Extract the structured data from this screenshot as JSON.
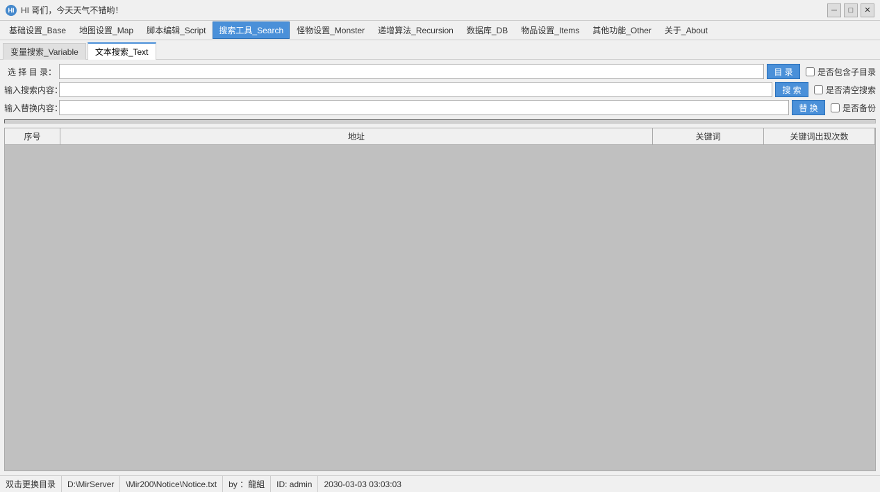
{
  "titlebar": {
    "title": "HI 哥们，今天天气不错哟！",
    "minimize": "─",
    "maximize": "□",
    "close": "✕"
  },
  "menubar": {
    "items": [
      {
        "id": "base",
        "label": "基础设置_Base",
        "active": false
      },
      {
        "id": "map",
        "label": "地图设置_Map",
        "active": false
      },
      {
        "id": "script",
        "label": "脚本编辑_Script",
        "active": false
      },
      {
        "id": "search",
        "label": "搜索工具_Search",
        "active": true
      },
      {
        "id": "monster",
        "label": "怪物设置_Monster",
        "active": false
      },
      {
        "id": "recursion",
        "label": "递增算法_Recursion",
        "active": false
      },
      {
        "id": "db",
        "label": "数据库_DB",
        "active": false
      },
      {
        "id": "items",
        "label": "物品设置_Items",
        "active": false
      },
      {
        "id": "other",
        "label": "其他功能_Other",
        "active": false
      },
      {
        "id": "about",
        "label": "关于_About",
        "active": false
      }
    ]
  },
  "tabs": [
    {
      "id": "variable",
      "label": "变量搜索_Variable",
      "active": false
    },
    {
      "id": "text",
      "label": "文本搜索_Text",
      "active": true
    }
  ],
  "form": {
    "dir_label": "选 择 目 录：",
    "dir_value": "",
    "dir_btn": "目  录",
    "search_label": "输入搜索内容：",
    "search_value": "",
    "search_btn": "搜  索",
    "replace_label": "输入替换内容：",
    "replace_value": "",
    "replace_btn": "替  换",
    "checkbox1": "是否包含子目录",
    "checkbox2": "是否清空搜索",
    "checkbox3": "是否备份"
  },
  "table": {
    "columns": [
      {
        "id": "num",
        "label": "序号"
      },
      {
        "id": "addr",
        "label": "地址"
      },
      {
        "id": "kw",
        "label": "关键词"
      },
      {
        "id": "count",
        "label": "关键词出现次数"
      }
    ],
    "rows": []
  },
  "statusbar": {
    "action_label": "双击更换目录",
    "path1": "D:\\MirServer",
    "path2": "\\Mir200\\Notice\\Notice.txt",
    "by_label": "by ：",
    "by_value": "龍組",
    "id_label": "ID:",
    "id_value": "admin",
    "datetime": "2030-03-03  03:03:03"
  }
}
